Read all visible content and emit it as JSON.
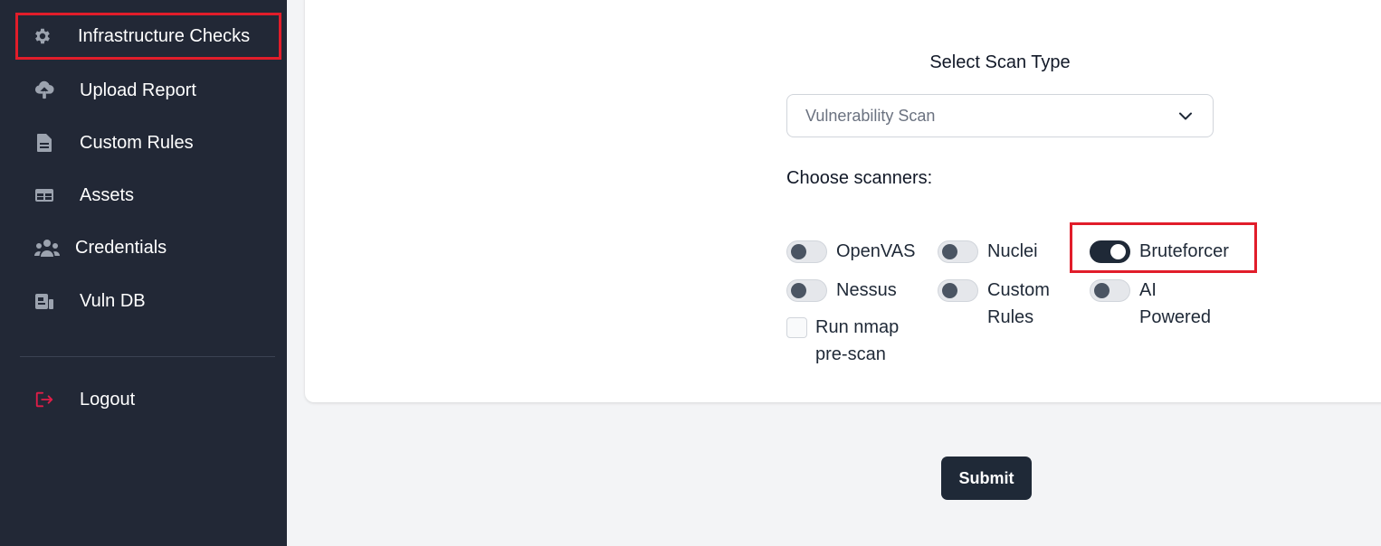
{
  "sidebar": {
    "items": [
      {
        "label": "Infrastructure Checks",
        "icon": "gear-icon"
      },
      {
        "label": "Upload Report",
        "icon": "cloud-upload-icon"
      },
      {
        "label": "Custom Rules",
        "icon": "document-icon"
      },
      {
        "label": "Assets",
        "icon": "table-icon"
      },
      {
        "label": "Credentials",
        "icon": "users-icon"
      },
      {
        "label": "Vuln DB",
        "icon": "database-icon"
      }
    ],
    "logout": {
      "label": "Logout",
      "icon": "logout-icon"
    }
  },
  "form": {
    "scan_type_title": "Select Scan Type",
    "scan_type_value": "Vulnerability Scan",
    "choose_label": "Choose scanners:",
    "scanners": [
      {
        "label": "OpenVAS",
        "enabled": false
      },
      {
        "label": "Nuclei",
        "enabled": false
      },
      {
        "label": "Bruteforcer",
        "enabled": true
      },
      {
        "label": "Nessus",
        "enabled": false
      },
      {
        "label": "Custom Rules",
        "enabled": false
      },
      {
        "label": "AI Powered",
        "enabled": false
      }
    ],
    "nmap_label": "Run nmap pre-scan",
    "nmap_checked": false,
    "submit_label": "Submit"
  },
  "colors": {
    "sidebar_bg": "#222836",
    "highlight": "#e11d2a",
    "logout_icon": "#e11d48",
    "primary_button": "#1f2937"
  }
}
